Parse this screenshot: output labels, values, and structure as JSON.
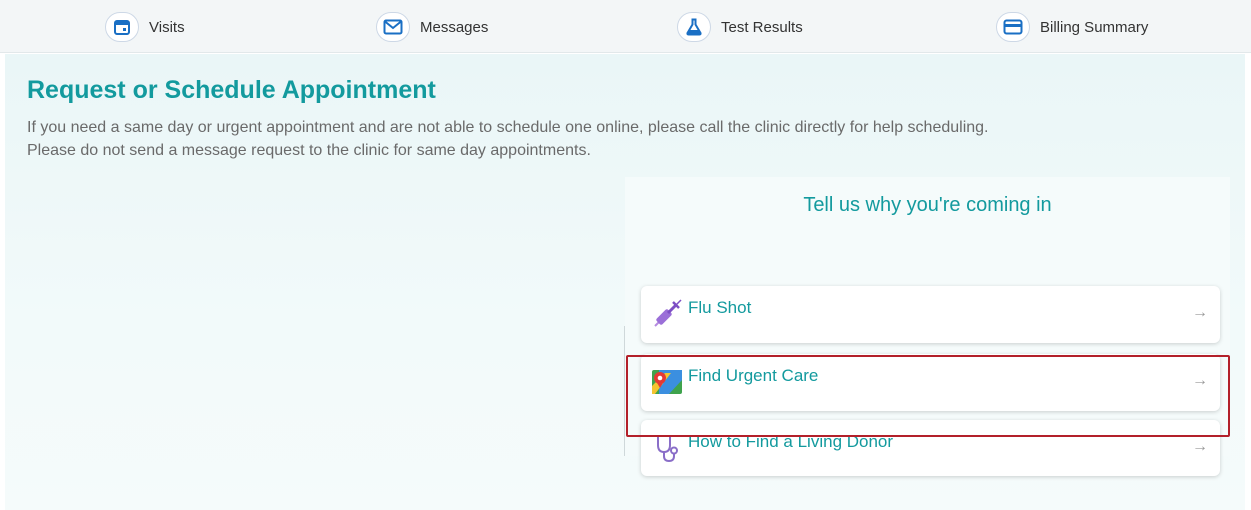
{
  "nav": {
    "items": [
      {
        "label": "Visits",
        "icon": "calendar-icon"
      },
      {
        "label": "Messages",
        "icon": "envelope-icon"
      },
      {
        "label": "Test Results",
        "icon": "flask-icon"
      },
      {
        "label": "Billing Summary",
        "icon": "credit-card-icon"
      }
    ]
  },
  "page": {
    "title": "Request or Schedule Appointment",
    "intro_line1": "If you need a same day or urgent appointment and are not able to schedule one online, please call the clinic directly for help scheduling.",
    "intro_line2": "Please do not send a message request to the clinic for same day appointments."
  },
  "reasons": {
    "title": "Tell us why you're coming in",
    "items": [
      {
        "label": "Flu Shot",
        "icon": "syringe-icon"
      },
      {
        "label": "Find Urgent Care",
        "icon": "map-icon"
      },
      {
        "label": "How to Find a Living Donor",
        "icon": "stethoscope-icon"
      }
    ],
    "arrow": "→"
  },
  "colors": {
    "accent": "#139a9e",
    "highlight": "#b3202a",
    "icon_blue": "#1a6fc4"
  }
}
